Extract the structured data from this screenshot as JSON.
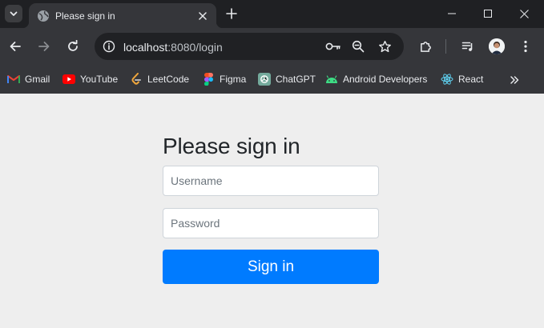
{
  "tab": {
    "title": "Please sign in",
    "favicon": "globe-icon"
  },
  "toolbar": {
    "url_host": "localhost",
    "url_rest": ":8080/login",
    "icons": [
      "back-arrow-icon",
      "forward-arrow-icon",
      "reload-icon",
      "site-info-icon",
      "password-key-icon",
      "zoom-icon",
      "bookmark-star-icon",
      "extensions-icon",
      "media-controls-icon",
      "profile-avatar-icon",
      "kebab-menu-icon"
    ]
  },
  "bookmarks": [
    {
      "label": "Gmail",
      "icon": "gmail-icon"
    },
    {
      "label": "YouTube",
      "icon": "youtube-icon"
    },
    {
      "label": "LeetCode",
      "icon": "leetcode-icon"
    },
    {
      "label": "Figma",
      "icon": "figma-icon"
    },
    {
      "label": "ChatGPT",
      "icon": "chatgpt-icon"
    },
    {
      "label": "Android Developers",
      "icon": "android-icon"
    },
    {
      "label": "React",
      "icon": "react-icon"
    }
  ],
  "form": {
    "heading": "Please sign in",
    "username_placeholder": "Username",
    "username_value": "",
    "password_placeholder": "Password",
    "password_value": "",
    "submit_label": "Sign in"
  },
  "colors": {
    "primary_button": "#007bff",
    "page_background": "#eeeeee",
    "browser_frame": "#35363a"
  }
}
